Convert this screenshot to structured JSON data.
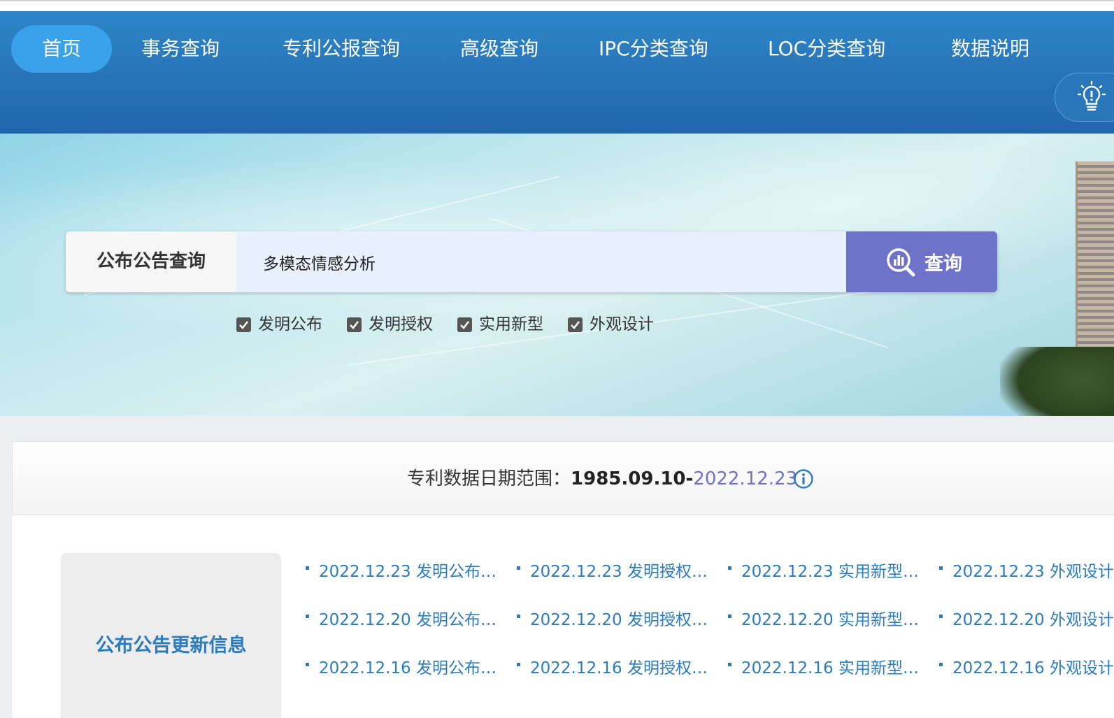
{
  "nav": {
    "items": [
      {
        "label": "首页",
        "active": true
      },
      {
        "label": "事务查询"
      },
      {
        "label": "专利公报查询"
      },
      {
        "label": "高级查询"
      },
      {
        "label": "IPC分类查询"
      },
      {
        "label": "LOC分类查询"
      },
      {
        "label": "数据说明"
      }
    ],
    "tip_icon": "lightbulb-icon"
  },
  "search": {
    "label": "公布公告查询",
    "value": "多模态情感分析",
    "button_label": "查询",
    "options": [
      {
        "label": "发明公布",
        "checked": true
      },
      {
        "label": "发明授权",
        "checked": true
      },
      {
        "label": "实用新型",
        "checked": true
      },
      {
        "label": "外观设计",
        "checked": true
      }
    ]
  },
  "date_range": {
    "label": "专利数据日期范围：",
    "start": "1985.09.10-",
    "end": "2022.12.23"
  },
  "updates": {
    "title": "公布公告更新信息",
    "rows": [
      [
        "2022.12.23 发明公布…",
        "2022.12.23 发明授权…",
        "2022.12.23 实用新型…",
        "2022.12.23 外观设计"
      ],
      [
        "2022.12.20 发明公布…",
        "2022.12.20 发明授权…",
        "2022.12.20 实用新型…",
        "2022.12.20 外观设计"
      ],
      [
        "2022.12.16 发明公布…",
        "2022.12.16 发明授权…",
        "2022.12.16 实用新型…",
        "2022.12.16 外观设计"
      ]
    ]
  },
  "colors": {
    "nav_bg": "#2773b8",
    "nav_active": "#3aa2ea",
    "accent": "#6e73c9",
    "link": "#2b7bbf"
  }
}
